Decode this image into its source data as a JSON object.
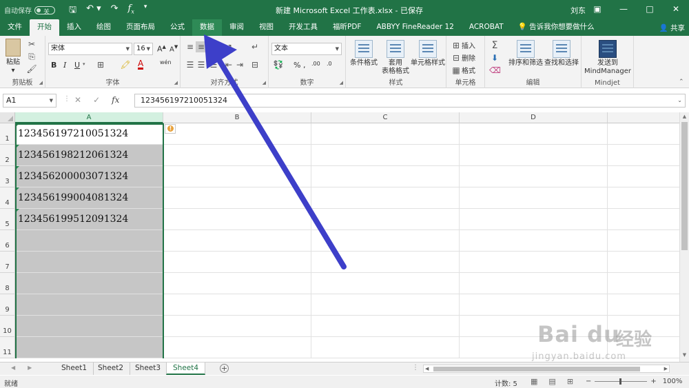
{
  "titlebar": {
    "autosave_label": "自动保存",
    "autosave_state": "关",
    "title": "新建 Microsoft Excel 工作表.xlsx - 已保存",
    "user": "刘东",
    "qat": [
      "save-icon",
      "undo-icon",
      "redo-icon",
      "fx-icon"
    ]
  },
  "tabs": [
    "文件",
    "开始",
    "插入",
    "绘图",
    "页面布局",
    "公式",
    "数据",
    "审阅",
    "视图",
    "开发工具",
    "福昕PDF",
    "ABBYY FineReader 12",
    "ACROBAT"
  ],
  "active_tab": "开始",
  "tell_me": "告诉我你想要做什么",
  "share": "共享",
  "ribbon": {
    "clipboard": {
      "label": "剪贴板",
      "paste": "粘贴"
    },
    "font": {
      "label": "字体",
      "font_name": "宋体",
      "font_size": "16",
      "bold": "B",
      "italic": "I",
      "underline": "U"
    },
    "alignment": {
      "label": "对齐方式"
    },
    "number": {
      "label": "数字",
      "format": "文本",
      "percent": "%"
    },
    "styles": {
      "label": "样式",
      "conditional": "条件格式",
      "table_line1": "套用",
      "table_line2": "表格格式",
      "cell_styles": "单元格样式"
    },
    "cells": {
      "label": "单元格",
      "insert": "插入",
      "delete": "删除",
      "format": "格式"
    },
    "editing": {
      "label": "编辑",
      "sort": "排序和筛选",
      "find": "查找和选择"
    },
    "mindjet": {
      "label": "Mindjet",
      "send_line1": "发送到",
      "send_line2": "MindManager"
    }
  },
  "formula_bar": {
    "name_box": "A1",
    "fx": "fx",
    "value": "123456197210051324"
  },
  "columns": [
    "A",
    "B",
    "C",
    "D"
  ],
  "rows": [
    "1",
    "2",
    "3",
    "4",
    "5",
    "6",
    "7",
    "8",
    "9",
    "10",
    "11"
  ],
  "cells_a": [
    "123456197210051324",
    "123456198212061324",
    "123456200003071324",
    "123456199004081324",
    "123456199512091324"
  ],
  "sheets": [
    "Sheet1",
    "Sheet2",
    "Sheet3",
    "Sheet4"
  ],
  "active_sheet": "Sheet4",
  "status": {
    "ready": "就绪",
    "count": "计数: 5",
    "zoom": "100%"
  },
  "colors": {
    "excel_green": "#217346",
    "arrow": "#3d3fc9"
  },
  "watermark": {
    "brand": "Bai du",
    "brand_cn": "经验",
    "url": "jingyan.baidu.com"
  }
}
